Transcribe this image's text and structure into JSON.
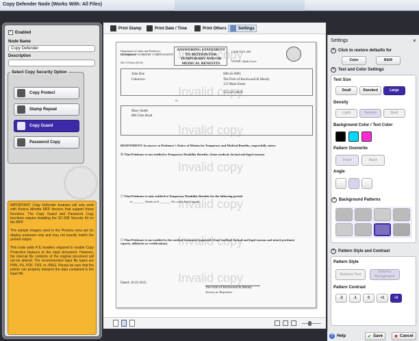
{
  "window": {
    "title": "Copy Defender Node   (Works With: All Files)"
  },
  "left": {
    "enabled_label": "Enabled",
    "node_name_label": "Node Name",
    "node_name_value": "Copy Defender",
    "description_label": "Description",
    "description_value": "",
    "section_label": "Select Copy Security Option",
    "options": [
      {
        "label": "Copy Protect"
      },
      {
        "label": "Stamp Repeat"
      },
      {
        "label": "Copy Guard"
      },
      {
        "label": "Password Copy"
      }
    ],
    "note": [
      "IMPORTANT: Copy Defender features will only work with Konica Minolta MFP devices that support these functions. The Copy Guard and Password Copy functions require installing the SC-508 Security Kit on the MFP.",
      "The sample images used in the Preview area are for display purposes only and may not exactly match the printed output.",
      "This node adds PJL headers required to enable Copy Protection features to the input document. However, the internal file contents of the original document will not be altered. The recommended input file types are PRN, PS, PDF, TIFF, or JPEG. Please be sure that the printer can properly interpret the data contained in the input file."
    ]
  },
  "toolbar": {
    "print_stamp": "Print Stamp",
    "print_date_time": "Print Date / Time",
    "print_others": "Print Others",
    "settings": "Settings"
  },
  "doc": {
    "watermark": "Invalid copy",
    "dept": "Department of Labor and Workforce Development",
    "division": "DIVISION OF WORKERS' COMPENSATION",
    "form_no": "WC-170 (rev 03/15)",
    "heading": "ANSWERING STATEMENT TO MOTION FOR TEMPORARY AND/OR MEDICAL BENEFITS",
    "case_no": "CASE NO'S: 000",
    "venue": "VENUE: Shady Grove",
    "petitioner_name": "John Doe",
    "petitioner_addr": "Unknown",
    "ssn": "000-45-0905",
    "atty_name": "The Firm of Rockwood & Moody",
    "atty_addr": "123 Main Street",
    "phone": "555-123-4678",
    "respondent_name": "Mary Smith",
    "respondent_addr": "880 Glen Road",
    "vs": "vs",
    "respondent_line": "RESPONDENT: In answer to Petitioner's Notice of Motion for Temporary and Medical Benefits, respectfully states:",
    "item1": "That Petitioner is not entitled to Temporary Disability Benefits. (State medical, factual and legal reasons)",
    "item2": "That Petitioner is only entitled to Temporary Disability Benefits for the following period:",
    "item2b": "to _______ Weeks at $ _______ Per week  Paid  Unpaid",
    "item3": "That Petitioner is not entitled to the medical treatment requested. (State medical, factual and legal reasons and attach pertinent reports, affidavits or certifications)",
    "dated": "Dated:  10-23-2015",
    "signer": "The Firm of Rockwood & Moody",
    "signer_role": "Attorney for Respondent"
  },
  "right": {
    "header": "Settings",
    "restore_label": "Click to restore defaults for",
    "color_btn": "Color",
    "bw_btn": "B&W",
    "text_color_section": "Text and Color Settings",
    "text_size_label": "Text Size",
    "text_sizes": [
      "Small",
      "Standard",
      "Large"
    ],
    "density_label": "Density",
    "densities": [
      "Light",
      "Normal",
      "Dark"
    ],
    "bg_text_color_label": "Background Color / Text Color",
    "colors": [
      "#000000",
      "#00d8ff",
      "#ff2ad4"
    ],
    "pattern_overwrite_label": "Pattern Overwrite",
    "overwrite_opts": [
      "Front",
      "Back"
    ],
    "angle_label": "Angle",
    "bg_patterns_section": "Background Patterns",
    "pattern_style_section": "Pattern Style and Contrast",
    "pattern_style_label": "Pattern Style",
    "style_opts": [
      "Emboss Text",
      "Emboss Background"
    ],
    "pattern_contrast_label": "Pattern Contrast",
    "contrast_opts": [
      "-2",
      "-1",
      "0",
      "+1",
      "+2"
    ]
  },
  "bottom": {
    "help": "Help",
    "save": "Save",
    "cancel": "Cancel"
  }
}
